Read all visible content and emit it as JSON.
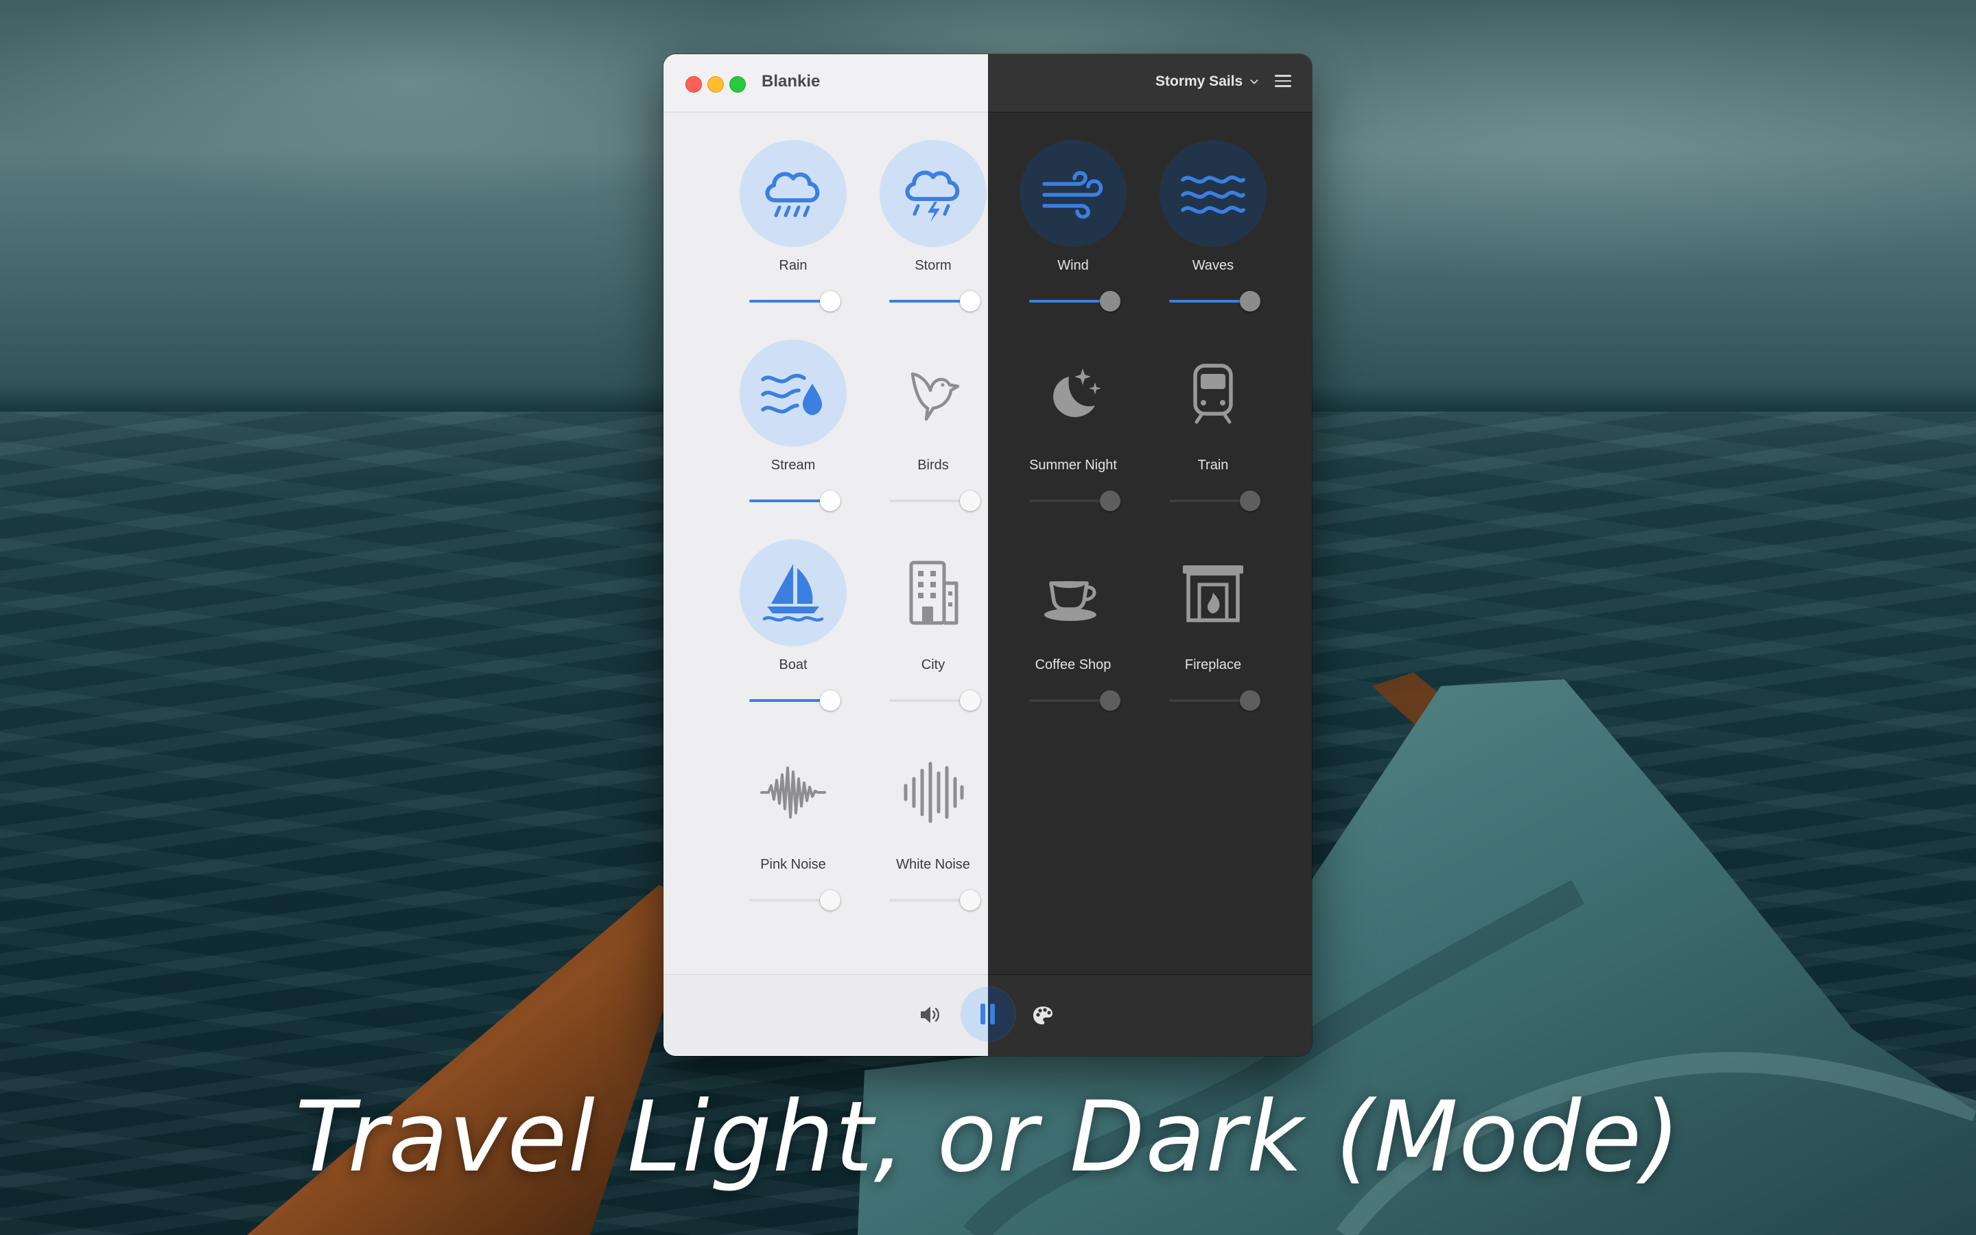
{
  "window": {
    "title": "Blankie",
    "preset": "Stormy Sails"
  },
  "sounds": [
    {
      "label": "Rain",
      "icon": "rain-cloud-icon",
      "active": true,
      "volume": 0.88
    },
    {
      "label": "Storm",
      "icon": "storm-cloud-icon",
      "active": true,
      "volume": 0.88
    },
    {
      "label": "Wind",
      "icon": "wind-icon",
      "active": true,
      "volume": 0.88
    },
    {
      "label": "Waves",
      "icon": "waves-icon",
      "active": true,
      "volume": 0.88
    },
    {
      "label": "Stream",
      "icon": "stream-drop-icon",
      "active": true,
      "volume": 0.88
    },
    {
      "label": "Birds",
      "icon": "bird-icon",
      "active": false,
      "volume": 0.88
    },
    {
      "label": "Summer Night",
      "icon": "moon-stars-icon",
      "active": false,
      "volume": 0.88
    },
    {
      "label": "Train",
      "icon": "train-icon",
      "active": false,
      "volume": 0.88
    },
    {
      "label": "Boat",
      "icon": "sailboat-icon",
      "active": true,
      "volume": 0.88
    },
    {
      "label": "City",
      "icon": "building-icon",
      "active": false,
      "volume": 0.88
    },
    {
      "label": "Coffee Shop",
      "icon": "coffee-cup-icon",
      "active": false,
      "volume": 0.88
    },
    {
      "label": "Fireplace",
      "icon": "fireplace-icon",
      "active": false,
      "volume": 0.88
    },
    {
      "label": "Pink Noise",
      "icon": "pink-noise-waveform-icon",
      "active": false,
      "volume": 0.88
    },
    {
      "label": "White Noise",
      "icon": "white-noise-waveform-icon",
      "active": false,
      "volume": 0.88
    }
  ],
  "toolbar": {
    "volume_icon": "speaker-volume-icon",
    "play_icon": "pause-icon",
    "theme_icon": "palette-icon"
  },
  "colors": {
    "accent": "#3b7fe0",
    "light_bg": "#eeedef",
    "dark_bg": "#2c2b2b",
    "active_light": "#cfe0f6",
    "active_dark": "#22344a"
  },
  "caption": "Travel Light, or Dark (Mode)"
}
